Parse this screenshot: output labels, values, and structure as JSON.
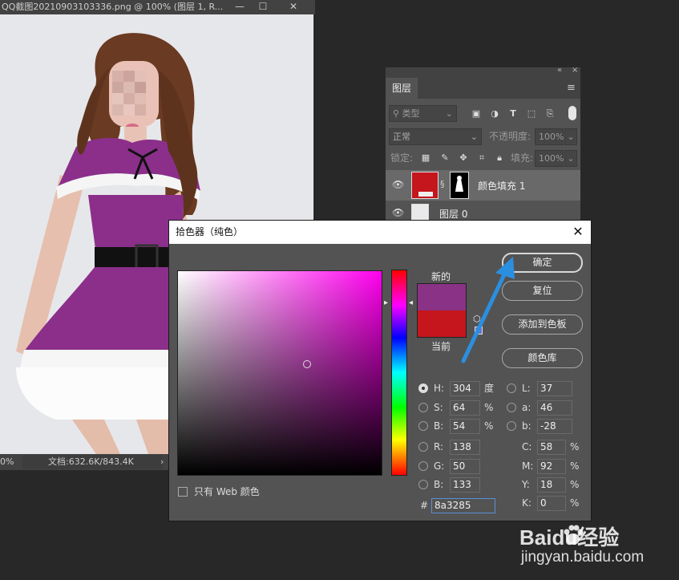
{
  "document": {
    "title": "QQ截图20210903103336.png @ 100% (图层 1, R...",
    "zoom": "0%",
    "doc_info": "文档:632.6K/843.4K"
  },
  "layers_panel": {
    "tab": "图层",
    "filter_placeholder": "类型",
    "blend_mode": "正常",
    "opacity_label": "不透明度:",
    "opacity_value": "100%",
    "lock_label": "锁定:",
    "fill_label": "填充:",
    "fill_value": "100%",
    "layers": [
      {
        "name": "颜色填充 1",
        "swatch": "#c4161c",
        "selected": true
      },
      {
        "name": "图层 0",
        "selected": false
      }
    ]
  },
  "color_picker": {
    "title": "拾色器（纯色）",
    "new_label": "新的",
    "current_label": "当前",
    "new_color": "#8a3285",
    "current_color": "#c4161c",
    "buttons": {
      "ok": "确定",
      "reset": "复位",
      "add_swatch": "添加到色板",
      "library": "颜色库"
    },
    "hsb": [
      {
        "label": "H:",
        "value": "304",
        "unit": "度",
        "selected": true
      },
      {
        "label": "S:",
        "value": "64",
        "unit": "%",
        "selected": false
      },
      {
        "label": "B:",
        "value": "54",
        "unit": "%",
        "selected": false
      }
    ],
    "lab": [
      {
        "label": "L:",
        "value": "37"
      },
      {
        "label": "a:",
        "value": "46"
      },
      {
        "label": "b:",
        "value": "-28"
      }
    ],
    "rgb": [
      {
        "label": "R:",
        "value": "138"
      },
      {
        "label": "G:",
        "value": "50"
      },
      {
        "label": "B:",
        "value": "133"
      }
    ],
    "cmyk": [
      {
        "label": "C:",
        "value": "58",
        "unit": "%"
      },
      {
        "label": "M:",
        "value": "92",
        "unit": "%"
      },
      {
        "label": "Y:",
        "value": "18",
        "unit": "%"
      },
      {
        "label": "K:",
        "value": "0",
        "unit": "%"
      }
    ],
    "hex_label": "#",
    "hex_value": "8a3285",
    "web_only_label": "只有 Web 颜色"
  },
  "watermark": {
    "brand": "Baidu经验",
    "url": "jingyan.baidu.com"
  },
  "colors": {
    "accent_arrow": "#2b8fe0",
    "dress": "#8b2f8a",
    "bg": "#282828"
  }
}
